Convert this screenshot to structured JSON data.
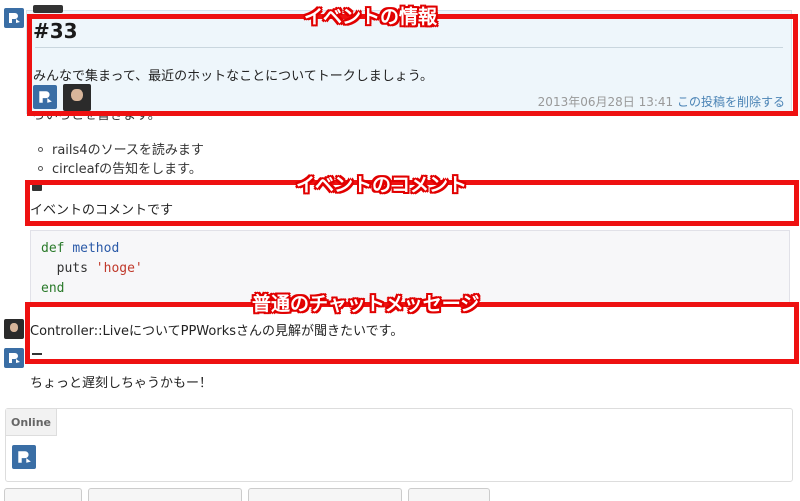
{
  "event": {
    "title": "#33",
    "description": "みんなで集まって、最近のホットなことについてトークしましょう。",
    "timestamp": "2013年06月28日 13:41",
    "delete_link": "この投稿を削除する",
    "badge": "　"
  },
  "partial_line": "ろいろとを書きます。",
  "bullets": [
    "rails4のソースを読みます",
    "circleafの告知をします。"
  ],
  "comment": {
    "text": "イベントのコメントです"
  },
  "code": {
    "keyword_def": "def",
    "method_name": "method",
    "call": "puts",
    "string": "'hoge'",
    "keyword_end": "end"
  },
  "chat_message": {
    "text": "Controller::LiveについてPPWorksさんの見解が聞きたいです。"
  },
  "chat_message_2": {
    "text": "ちょっと遅刻しちゃうかもー！"
  },
  "online": {
    "tab_label": "Online"
  },
  "annotations": {
    "event_info": "イベントの情報",
    "event_comment": "イベントのコメント",
    "chat_message": "普通のチャットメッセージ",
    "color": "#ee1111"
  },
  "colors": {
    "brand_blue": "#3a6ea5",
    "event_bg": "#eef6fb",
    "link": "#4a83b5"
  }
}
